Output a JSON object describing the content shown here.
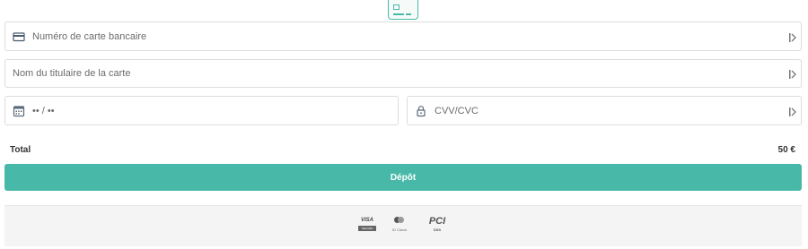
{
  "form": {
    "card_number": {
      "placeholder": "Numéro de carte bancaire",
      "icon": "credit-card-icon",
      "trail_icon": "autofill-icon"
    },
    "holder_name": {
      "placeholder": "Nom du titulaire de la carte",
      "trail_icon": "autofill-icon"
    },
    "expiry": {
      "placeholder": "•• / ••",
      "icon": "calendar-icon"
    },
    "cvv": {
      "placeholder": "CVV/CVC",
      "icon": "lock-icon",
      "trail_icon": "autofill-icon"
    }
  },
  "summary": {
    "total_label": "Total",
    "total_value": "50 €"
  },
  "actions": {
    "deposit_label": "Dépôt"
  },
  "footer": {
    "visa_text": "VISA",
    "visa_sub": "SECURE",
    "mastercard_text": "ID Check",
    "pci_text": "PCI",
    "pci_sub": "DSS"
  },
  "colors": {
    "accent": "#48b9a8",
    "border": "#dcdcdc",
    "footer_bg": "#f4f4f4"
  }
}
